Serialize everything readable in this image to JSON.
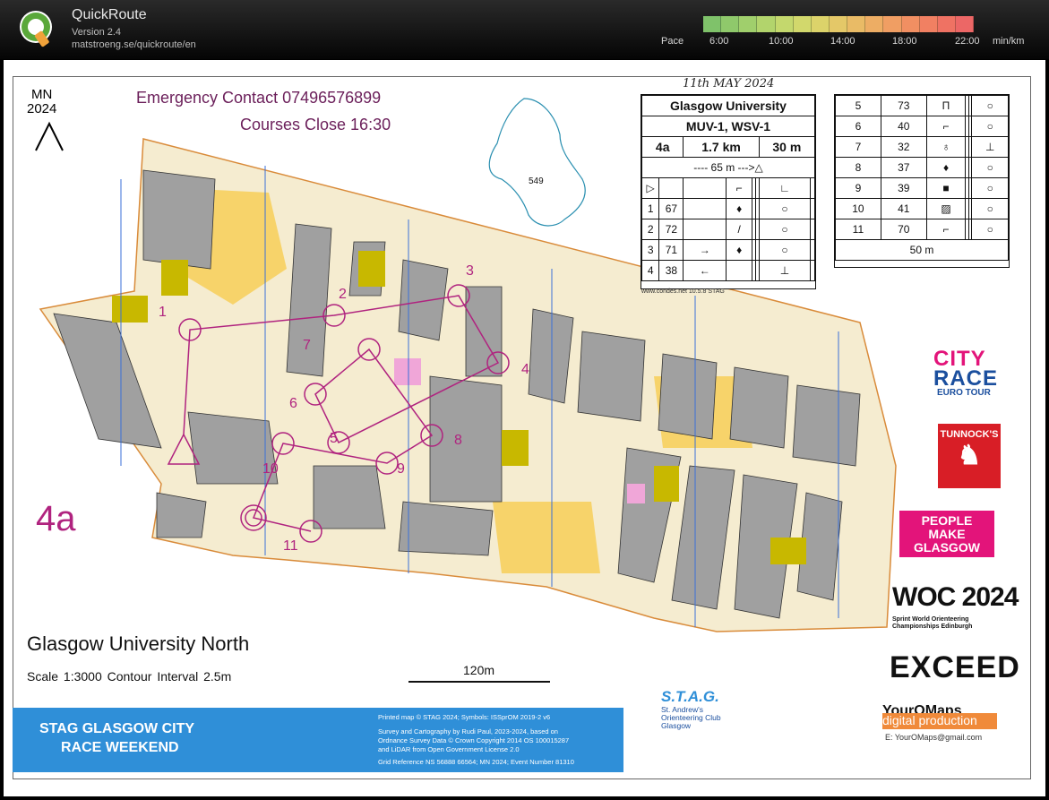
{
  "app": {
    "title": "QuickRoute",
    "version": "Version 2.4",
    "url": "matstroeng.se/quickroute/en",
    "logo_letter": "Q"
  },
  "pace": {
    "label": "Pace",
    "ticks": [
      "6:00",
      "10:00",
      "14:00",
      "18:00",
      "22:00"
    ],
    "unit": "min/km",
    "colors": [
      "#7fc26a",
      "#8fc96b",
      "#a0cf6c",
      "#b2d46c",
      "#c4d86d",
      "#d2d86c",
      "#dcd36a",
      "#e4c868",
      "#e9bb66",
      "#edad64",
      "#f09e63",
      "#f18f62",
      "#f18062",
      "#ef7263",
      "#ec6766"
    ]
  },
  "map": {
    "north": "MN\n2024",
    "north_line1": "MN",
    "north_line2": "2024",
    "emergency": "Emergency Contact 07496576899",
    "courses_close": "Courses Close 16:30",
    "course_big": "4a",
    "name": "Glasgow University North",
    "scale_info": "Scale 1:3000     Contour Interval 2.5m",
    "scalebar": "120m",
    "handwritten_date": "11th MAY 2024",
    "inset_number": "549",
    "controls": [
      "1",
      "2",
      "3",
      "4",
      "5",
      "6",
      "7",
      "8",
      "9",
      "10",
      "11"
    ],
    "colors": {
      "course": "#b0237f",
      "building": "#a0a0a0",
      "open": "#f7d36a",
      "vegetation": "#c8b800",
      "paved": "#f5ecd0"
    }
  },
  "descriptions": {
    "event": "Glasgow University",
    "classes": "MUV-1, WSV-1",
    "course": "4a",
    "length": "1.7 km",
    "climb": "30 m",
    "start_note": "---- 65 m --->△",
    "rows_a": [
      [
        "1",
        "67"
      ],
      [
        "2",
        "72"
      ],
      [
        "3",
        "71"
      ],
      [
        "4",
        "38"
      ]
    ],
    "rows_b": [
      [
        "5",
        "73"
      ],
      [
        "6",
        "40"
      ],
      [
        "7",
        "32"
      ],
      [
        "8",
        "37"
      ],
      [
        "9",
        "39"
      ],
      [
        "10",
        "41"
      ],
      [
        "11",
        "70"
      ]
    ],
    "finish": "50 m",
    "footer": "www.condes.net 10.5.8 STAG"
  },
  "banner": {
    "line1": "STAG GLASGOW CITY",
    "line2": "RACE WEEKEND",
    "small1": "Printed map © STAG 2024; Symbols: ISSprOM 2019-2 v6",
    "small2": "Survey and Cartography by Rudi Paul, 2023-2024, based on",
    "small3": "Ordnance Survey Data © Crown Copyright 2014 OS 100015287",
    "small4": "and LiDAR from Open Government License 2.0",
    "small5": "Grid Reference NS 56888 66564; MN 2024; Event Number 81310"
  },
  "sponsors": {
    "city": "CITY",
    "race": "RACE",
    "euro": "EURO TOUR",
    "tunnocks": "TUNNOCK'S",
    "pmg": "PEOPLE MAKE GLASGOW",
    "woc": "WOC 2024",
    "woc_sub1": "Sprint World Orienteering",
    "woc_sub2": "Championships Edinburgh",
    "exceed": "EXCEED",
    "yo1": "YourOMaps",
    "yo2": "digital production",
    "yo_email": "E: YourOMaps@gmail.com",
    "stag": "S.T.A.G.",
    "stag_sub1": "St. Andrew's",
    "stag_sub2": "Orienteering Club",
    "stag_sub3": "Glasgow"
  }
}
